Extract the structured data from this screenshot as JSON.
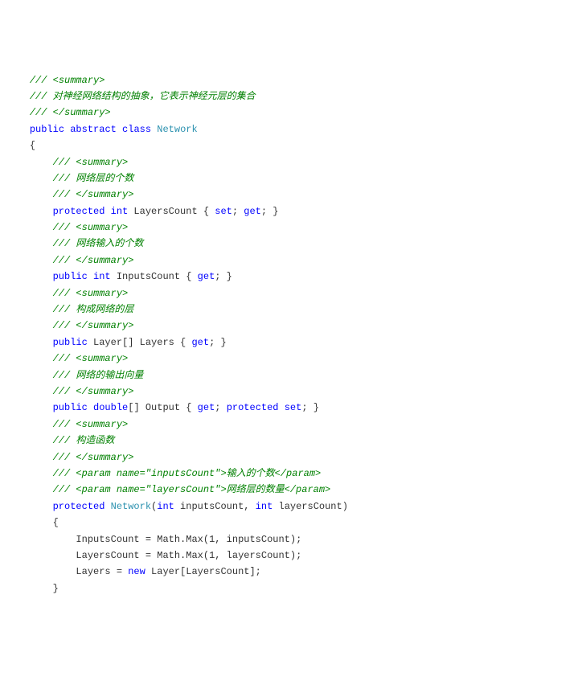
{
  "code": {
    "lines": [
      {
        "indent": 1,
        "segs": [
          [
            "cm",
            "/// <summary>"
          ]
        ]
      },
      {
        "indent": 1,
        "segs": [
          [
            "cm",
            "/// 对神经网络结构的抽象，它表示神经元层的集合"
          ]
        ]
      },
      {
        "indent": 1,
        "segs": [
          [
            "cm",
            "/// </summary>"
          ]
        ]
      },
      {
        "indent": 1,
        "segs": [
          [
            "kw",
            "public"
          ],
          [
            "pl",
            " "
          ],
          [
            "kw",
            "abstract"
          ],
          [
            "pl",
            " "
          ],
          [
            "kw",
            "class"
          ],
          [
            "pl",
            " "
          ],
          [
            "ty",
            "Network"
          ]
        ]
      },
      {
        "indent": 1,
        "segs": [
          [
            "pl",
            "{"
          ]
        ]
      },
      {
        "indent": 2,
        "segs": [
          [
            "cm",
            "/// <summary>"
          ]
        ]
      },
      {
        "indent": 2,
        "segs": [
          [
            "cm",
            "/// 网络层的个数"
          ]
        ]
      },
      {
        "indent": 2,
        "segs": [
          [
            "cm",
            "/// </summary>"
          ]
        ]
      },
      {
        "indent": 2,
        "segs": [
          [
            "kw",
            "protected"
          ],
          [
            "pl",
            " "
          ],
          [
            "kw",
            "int"
          ],
          [
            "pl",
            " LayersCount { "
          ],
          [
            "kw",
            "set"
          ],
          [
            "pl",
            "; "
          ],
          [
            "kw",
            "get"
          ],
          [
            "pl",
            "; }"
          ]
        ]
      },
      {
        "indent": 0,
        "segs": [
          [
            "pl",
            ""
          ]
        ]
      },
      {
        "indent": 2,
        "segs": [
          [
            "cm",
            "/// <summary>"
          ]
        ]
      },
      {
        "indent": 2,
        "segs": [
          [
            "cm",
            "/// 网络输入的个数"
          ]
        ]
      },
      {
        "indent": 2,
        "segs": [
          [
            "cm",
            "/// </summary>"
          ]
        ]
      },
      {
        "indent": 2,
        "segs": [
          [
            "kw",
            "public"
          ],
          [
            "pl",
            " "
          ],
          [
            "kw",
            "int"
          ],
          [
            "pl",
            " InputsCount { "
          ],
          [
            "kw",
            "get"
          ],
          [
            "pl",
            "; }"
          ]
        ]
      },
      {
        "indent": 0,
        "segs": [
          [
            "pl",
            ""
          ]
        ]
      },
      {
        "indent": 2,
        "segs": [
          [
            "cm",
            "/// <summary>"
          ]
        ]
      },
      {
        "indent": 2,
        "segs": [
          [
            "cm",
            "/// 构成网络的层"
          ]
        ]
      },
      {
        "indent": 2,
        "segs": [
          [
            "cm",
            "/// </summary>"
          ]
        ]
      },
      {
        "indent": 2,
        "segs": [
          [
            "kw",
            "public"
          ],
          [
            "pl",
            " Layer[] Layers { "
          ],
          [
            "kw",
            "get"
          ],
          [
            "pl",
            "; }"
          ]
        ]
      },
      {
        "indent": 0,
        "segs": [
          [
            "pl",
            ""
          ]
        ]
      },
      {
        "indent": 2,
        "segs": [
          [
            "cm",
            "/// <summary>"
          ]
        ]
      },
      {
        "indent": 2,
        "segs": [
          [
            "cm",
            "/// 网络的输出向量"
          ]
        ]
      },
      {
        "indent": 2,
        "segs": [
          [
            "cm",
            "/// </summary>"
          ]
        ]
      },
      {
        "indent": 2,
        "segs": [
          [
            "kw",
            "public"
          ],
          [
            "pl",
            " "
          ],
          [
            "kw",
            "double"
          ],
          [
            "pl",
            "[] Output { "
          ],
          [
            "kw",
            "get"
          ],
          [
            "pl",
            "; "
          ],
          [
            "kw",
            "protected"
          ],
          [
            "pl",
            " "
          ],
          [
            "kw",
            "set"
          ],
          [
            "pl",
            "; }"
          ]
        ]
      },
      {
        "indent": 0,
        "segs": [
          [
            "pl",
            ""
          ]
        ]
      },
      {
        "indent": 2,
        "segs": [
          [
            "cm",
            "/// <summary>"
          ]
        ]
      },
      {
        "indent": 2,
        "segs": [
          [
            "cm",
            "/// 构造函数"
          ]
        ]
      },
      {
        "indent": 2,
        "segs": [
          [
            "cm",
            "/// </summary>"
          ]
        ]
      },
      {
        "indent": 2,
        "segs": [
          [
            "cm",
            "/// <param name=\"inputsCount\">输入的个数</param>"
          ]
        ]
      },
      {
        "indent": 2,
        "segs": [
          [
            "cm",
            "/// <param name=\"layersCount\">网络层的数量</param>"
          ]
        ]
      },
      {
        "indent": 2,
        "segs": [
          [
            "kw",
            "protected"
          ],
          [
            "pl",
            " "
          ],
          [
            "ty",
            "Network"
          ],
          [
            "pl",
            "("
          ],
          [
            "kw",
            "int"
          ],
          [
            "pl",
            " inputsCount, "
          ],
          [
            "kw",
            "int"
          ],
          [
            "pl",
            " layersCount)"
          ]
        ]
      },
      {
        "indent": 2,
        "segs": [
          [
            "pl",
            "{"
          ]
        ]
      },
      {
        "indent": 3,
        "segs": [
          [
            "pl",
            "InputsCount = Math.Max("
          ],
          [
            "num",
            "1"
          ],
          [
            "pl",
            ", inputsCount);"
          ]
        ]
      },
      {
        "indent": 3,
        "segs": [
          [
            "pl",
            "LayersCount = Math.Max("
          ],
          [
            "num",
            "1"
          ],
          [
            "pl",
            ", layersCount);"
          ]
        ]
      },
      {
        "indent": 3,
        "segs": [
          [
            "pl",
            "Layers = "
          ],
          [
            "kw",
            "new"
          ],
          [
            "pl",
            " Layer[LayersCount];"
          ]
        ]
      },
      {
        "indent": 2,
        "segs": [
          [
            "pl",
            "}"
          ]
        ]
      }
    ]
  },
  "indent_unit": "    "
}
